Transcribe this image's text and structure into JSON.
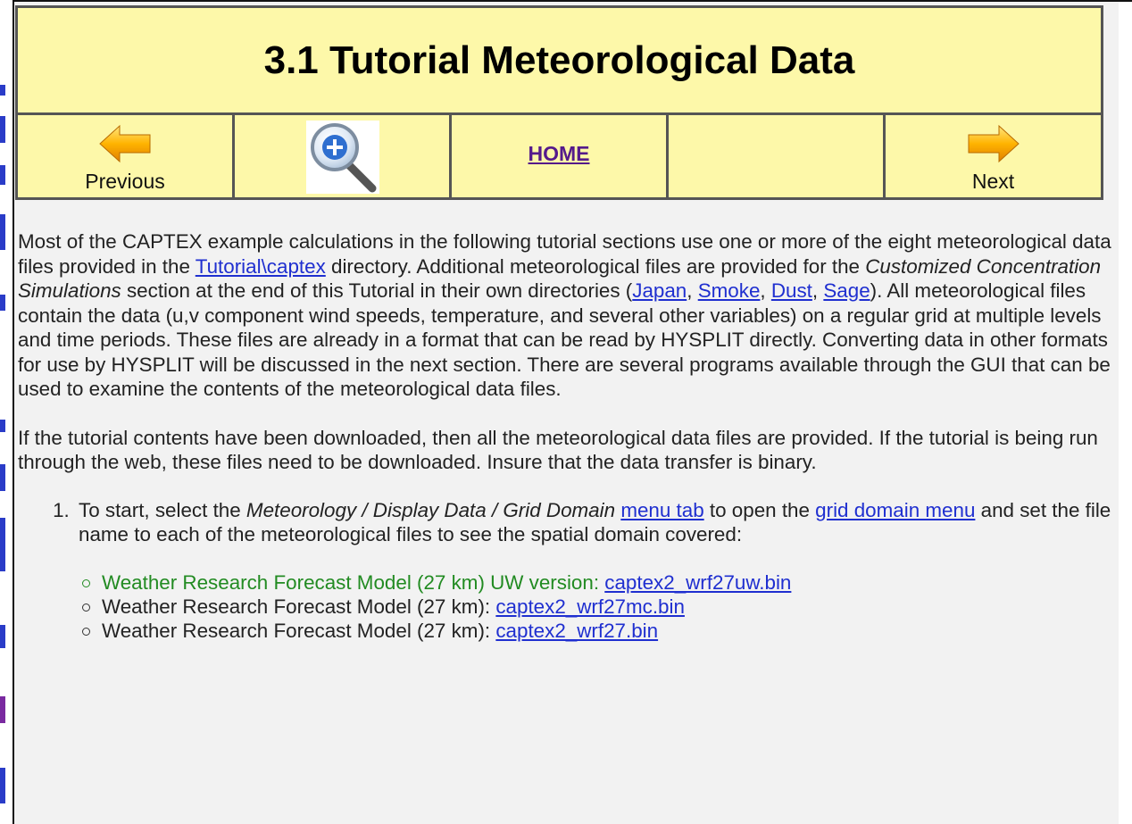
{
  "header": {
    "title": "3.1 Tutorial Meteorological Data",
    "nav": {
      "previous_label": "Previous",
      "home_label": "HOME",
      "next_label": "Next"
    }
  },
  "colors": {
    "header_bg": "#fdf8a9",
    "page_bg": "#f2f2f2",
    "link": "#1f2fd0",
    "visited_link": "#551a8b",
    "highlight_green": "#228b22"
  },
  "paragraph1": {
    "t1": "Most of the CAPTEX example calculations in the following tutorial sections use one or more of the eight meteorological data files provided in the ",
    "link_captex": "Tutorial\\captex",
    "t2": " directory. Additional meteorological files are provided for the ",
    "em": "Customized Concentration Simulations",
    "t3": " section at the end of this Tutorial in their own directories (",
    "link_japan": "Japan",
    "sep1": ", ",
    "link_smoke": "Smoke",
    "sep2": ", ",
    "link_dust": "Dust",
    "sep3": ", ",
    "link_sage": "Sage",
    "t4": "). All meteorological files contain the data (u,v component wind speeds, temperature, and several other variables) on a regular grid at multiple levels and time periods. These files are already in a format that can be read by HYSPLIT directly. Converting data in other formats for use by HYSPLIT will be discussed in the next section. There are several programs available through the GUI that can be used to examine the contents of the meteorological data files."
  },
  "paragraph2": "If the tutorial contents have been downloaded, then all the meteorological data files are provided. If the tutorial is being run through the web, these files need to be downloaded. Insure that the data transfer is binary.",
  "steps": [
    {
      "t1": "To start, select the ",
      "em": "Meteorology / Display Data / Grid Domain",
      "sp": " ",
      "link1": "menu tab",
      "t2": " to open the ",
      "link2": "grid domain menu",
      "t3": " and set the file name to each of the meteorological files to see the spatial domain covered:"
    }
  ],
  "files": [
    {
      "desc": "Weather Research Forecast Model (27 km) UW version: ",
      "file": "captex2_wrf27uw.bin"
    },
    {
      "desc": "Weather Research Forecast Model (27 km): ",
      "file": "captex2_wrf27mc.bin"
    },
    {
      "desc": "Weather Research Forecast Model (27 km): ",
      "file": "captex2_wrf27.bin"
    }
  ]
}
